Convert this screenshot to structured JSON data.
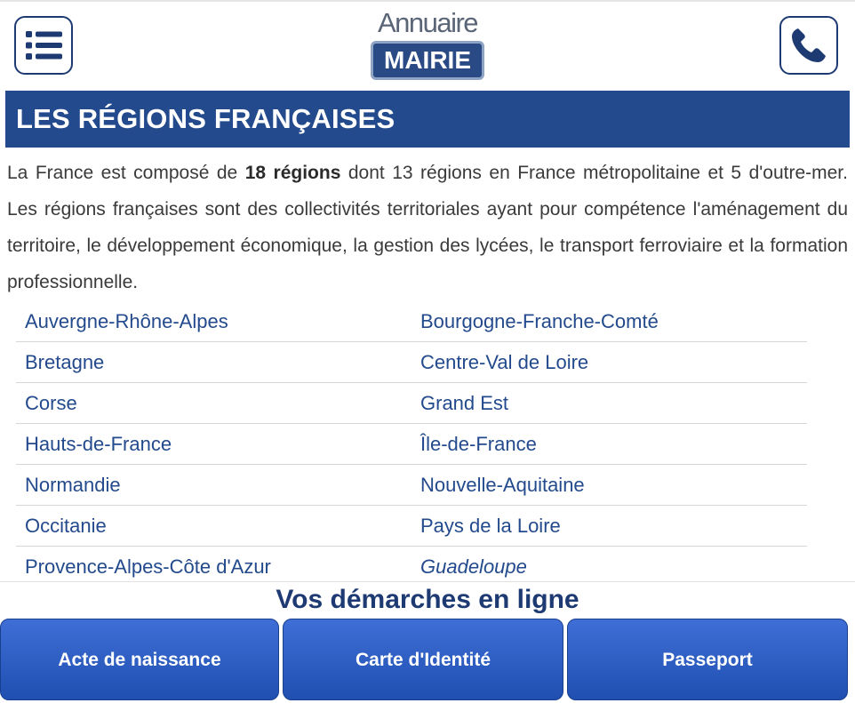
{
  "header": {
    "logo_top": "Annuaire",
    "logo_bottom": "MAIRIE",
    "menu_icon": "list-menu-icon",
    "phone_icon": "phone-icon"
  },
  "title": "LES RÉGIONS FRANÇAISES",
  "intro": {
    "part1": "La France est composé de ",
    "bold": "18 régions",
    "part2": " dont 13 régions en France métropolitaine et 5 d'outre-mer. Les régions françaises sont des collectivités territoriales ayant pour compétence l'aménagement du territoire, le développement économique, la gestion des lycées, le transport ferroviaire et la formation professionnelle."
  },
  "regions": [
    [
      "Auvergne-Rhône-Alpes",
      "Bourgogne-Franche-Comté"
    ],
    [
      "Bretagne",
      "Centre-Val de Loire"
    ],
    [
      "Corse",
      "Grand Est"
    ],
    [
      "Hauts-de-France",
      "Île-de-France"
    ],
    [
      "Normandie",
      "Nouvelle-Aquitaine"
    ],
    [
      "Occitanie",
      "Pays de la Loire"
    ],
    [
      "Provence-Alpes-Côte d'Azur",
      "Guadeloupe"
    ]
  ],
  "demarches": {
    "title": "Vos démarches en ligne",
    "buttons": [
      "Acte de naissance",
      "Carte d'Identité",
      "Passeport"
    ]
  },
  "colors": {
    "brand_navy": "#234a8c",
    "link_blue": "#234a8c",
    "button_blue": "#2f5fc4"
  }
}
